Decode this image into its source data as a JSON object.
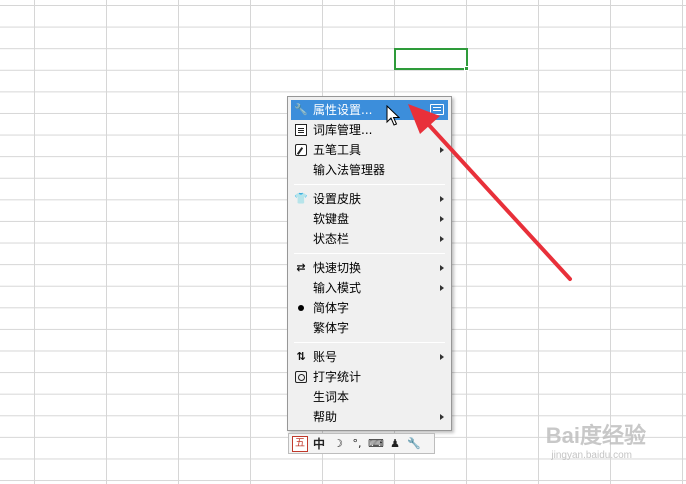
{
  "spreadsheet": {
    "selected_cell_color": "#2e9b3a"
  },
  "menu": {
    "items": [
      {
        "label": "属性设置...",
        "icon": "wrench-icon",
        "submenu": false,
        "active": true,
        "shortcut_icon": "keyboard-icon"
      },
      {
        "label": "词库管理...",
        "icon": "dictionary-icon",
        "submenu": false
      },
      {
        "label": "五笔工具",
        "icon": "pen-tool-icon",
        "submenu": true
      },
      {
        "label": "输入法管理器",
        "icon": "",
        "submenu": false
      },
      {
        "label": "设置皮肤",
        "icon": "shirt-icon",
        "submenu": true
      },
      {
        "label": "软键盘",
        "icon": "",
        "submenu": true
      },
      {
        "label": "状态栏",
        "icon": "",
        "submenu": true
      },
      {
        "label": "快速切换",
        "icon": "switch-icon",
        "submenu": true
      },
      {
        "label": "输入模式",
        "icon": "",
        "submenu": true
      },
      {
        "label": "简体字",
        "icon": "bullet-icon",
        "submenu": false
      },
      {
        "label": "繁体字",
        "icon": "",
        "submenu": false
      },
      {
        "label": "账号",
        "icon": "account-icon",
        "submenu": true
      },
      {
        "label": "打字统计",
        "icon": "stats-icon",
        "submenu": false
      },
      {
        "label": "生词本",
        "icon": "",
        "submenu": false
      },
      {
        "label": "帮助",
        "icon": "",
        "submenu": true
      }
    ],
    "active_color": "#3c8edb"
  },
  "ime_bar": {
    "logo": "五",
    "mode": "中",
    "icons": [
      "ime-logo-icon",
      "chinese-mode-icon",
      "moon-icon",
      "punctuation-icon",
      "keyboard-icon",
      "user-icon",
      "wrench-icon"
    ],
    "punct": "°,"
  },
  "annotation": {
    "arrow_color": "#e8303a"
  },
  "watermark": {
    "text": "Bai度经验",
    "sub": "jingyan.baidu.com"
  }
}
